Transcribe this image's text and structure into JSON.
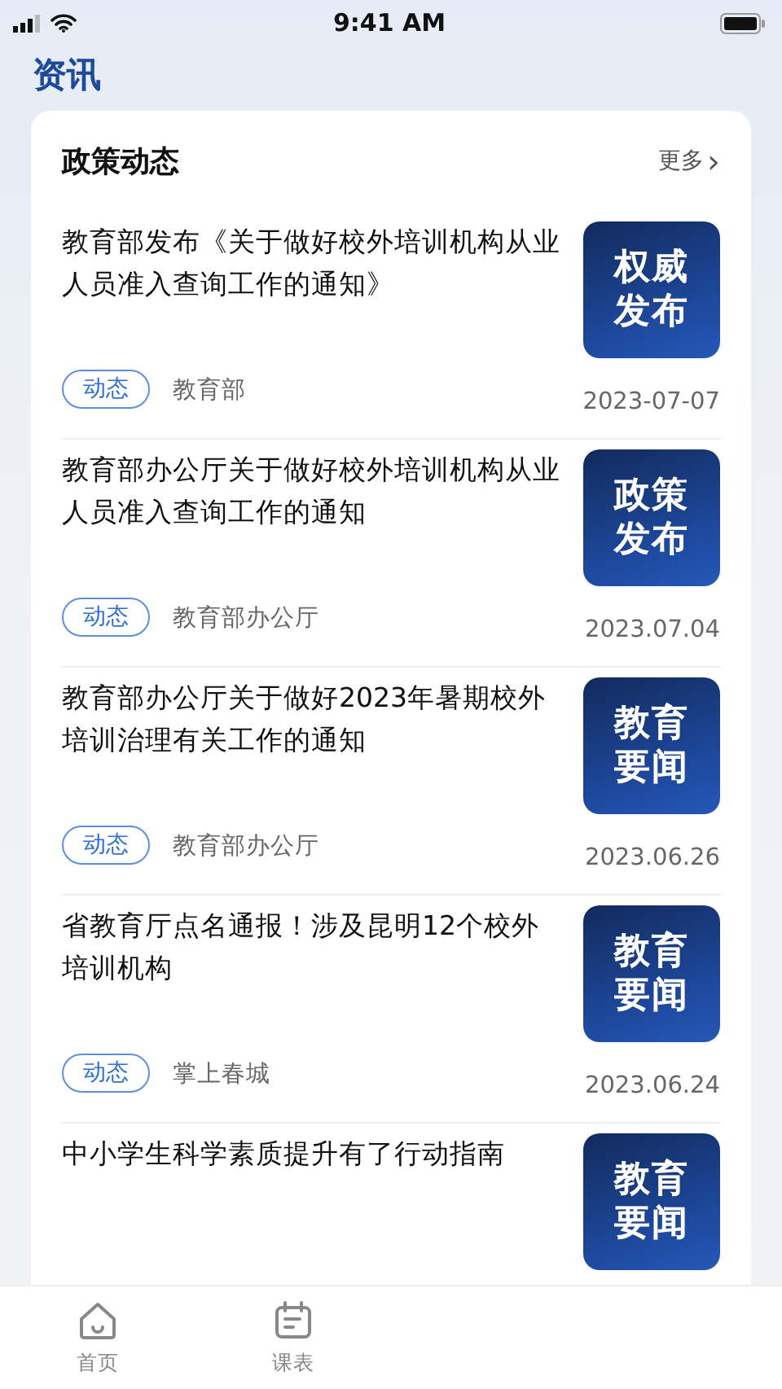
{
  "status_bar": {
    "time": "9:41 AM"
  },
  "header": {
    "title": "资讯"
  },
  "section": {
    "title": "政策动态",
    "more": "更多",
    "more_arrow": "›"
  },
  "news": [
    {
      "title": "教育部发布《关于做好校外培训机构从业人员准入查询工作的通知》",
      "thumb": "权威发布",
      "tag": "动态",
      "source": "教育部",
      "date": "2023-07-07"
    },
    {
      "title": "教育部办公厅关于做好校外培训机构从业人员准入查询工作的通知",
      "thumb": "政策发布",
      "tag": "动态",
      "source": "教育部办公厅",
      "date": "2023.07.04"
    },
    {
      "title": "教育部办公厅关于做好2023年暑期校外培训治理有关工作的通知",
      "thumb": "教育要闻",
      "tag": "动态",
      "source": "教育部办公厅",
      "date": "2023.06.26"
    },
    {
      "title": "省教育厅点名通报！涉及昆明12个校外培训机构",
      "thumb": "教育要闻",
      "tag": "动态",
      "source": "掌上春城",
      "date": "2023.06.24"
    },
    {
      "title": "中小学生科学素质提升有了行动指南",
      "thumb": "教育要闻"
    }
  ],
  "tab_bar": [
    {
      "label": "首页",
      "kind": "home",
      "selected": false
    },
    {
      "label": "课表",
      "kind": "schedule",
      "selected": false
    }
  ]
}
